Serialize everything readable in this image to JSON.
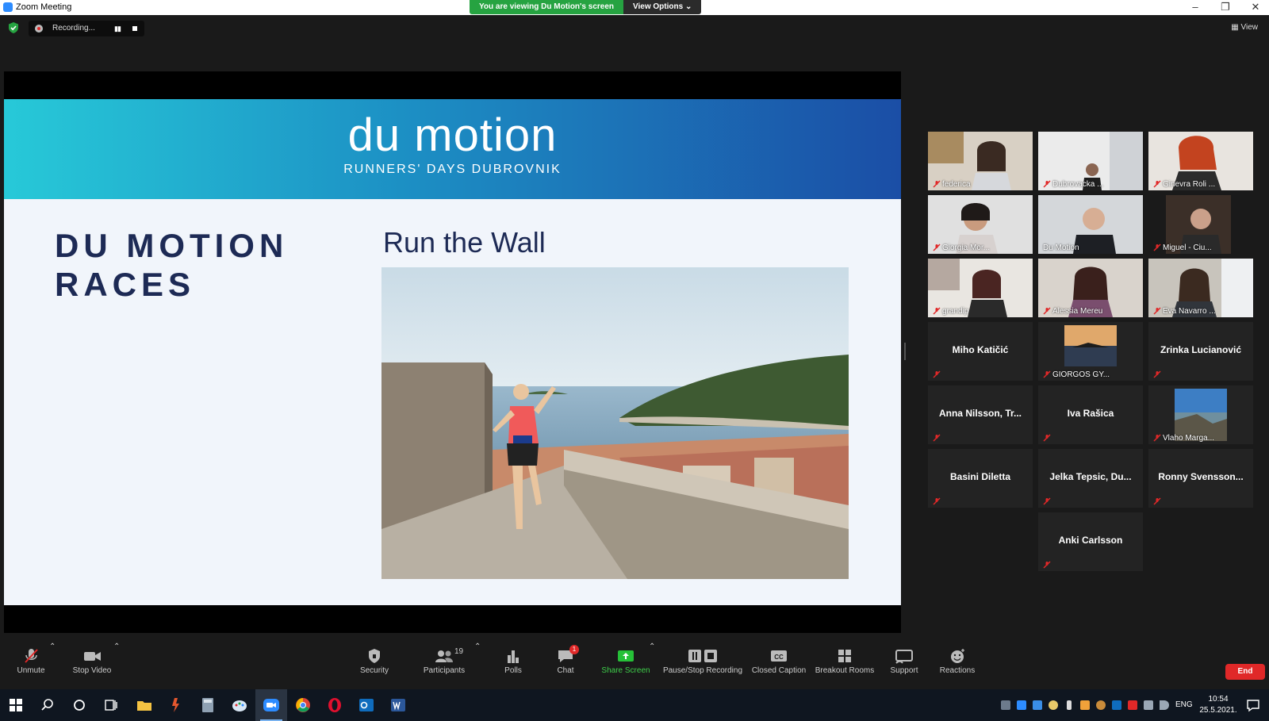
{
  "window": {
    "title": "Zoom Meeting",
    "share_banner": "You are viewing Du Motion's screen",
    "view_options": "View Options ⌄"
  },
  "meeting": {
    "recording_label": "Recording...",
    "view_label": "View"
  },
  "slide": {
    "brand_name": "du motion",
    "brand_tagline": "RUNNERS' DAYS DUBROVNIK",
    "heading": "DU MOTION RACES",
    "subheading": "Run the Wall"
  },
  "participants": [
    {
      "name": "federica"
    },
    {
      "name": "Dubrovacka ..."
    },
    {
      "name": "Ginevra Roli ..."
    },
    {
      "name": "Giorgia Mor..."
    },
    {
      "name": "Du Motion"
    },
    {
      "name": "Miguel - Ciu..."
    },
    {
      "name": "grandip"
    },
    {
      "name": "Alessia Mereu"
    },
    {
      "name": "Eva Navarro ..."
    },
    {
      "name": "Miho Katičić"
    },
    {
      "name": "GIORGOS GY..."
    },
    {
      "name": "Zrinka Lucianović"
    },
    {
      "name": "Anna Nilsson, Tr..."
    },
    {
      "name": "Iva Rašica"
    },
    {
      "name": "Vlaho Marga..."
    },
    {
      "name": "Basini Diletta"
    },
    {
      "name": "Jelka Tepsic, Du..."
    },
    {
      "name": "Ronny Svensson..."
    },
    {
      "name": "Anki Carlsson"
    }
  ],
  "toolbar": {
    "unmute": "Unmute",
    "stop_video": "Stop Video",
    "security": "Security",
    "participants": "Participants",
    "participant_count": "19",
    "polls": "Polls",
    "chat": "Chat",
    "chat_badge": "1",
    "share_screen": "Share Screen",
    "pause_stop_recording": "Pause/Stop Recording",
    "closed_caption": "Closed Caption",
    "breakout_rooms": "Breakout Rooms",
    "support": "Support",
    "reactions": "Reactions",
    "end": "End"
  },
  "taskbar": {
    "language": "ENG",
    "time": "10:54",
    "date": "25.5.2021."
  },
  "colors": {
    "share_green": "#26a341",
    "end_red": "#e02828",
    "active_speaker": "#d6df34",
    "slide_navy": "#1d2a55"
  }
}
